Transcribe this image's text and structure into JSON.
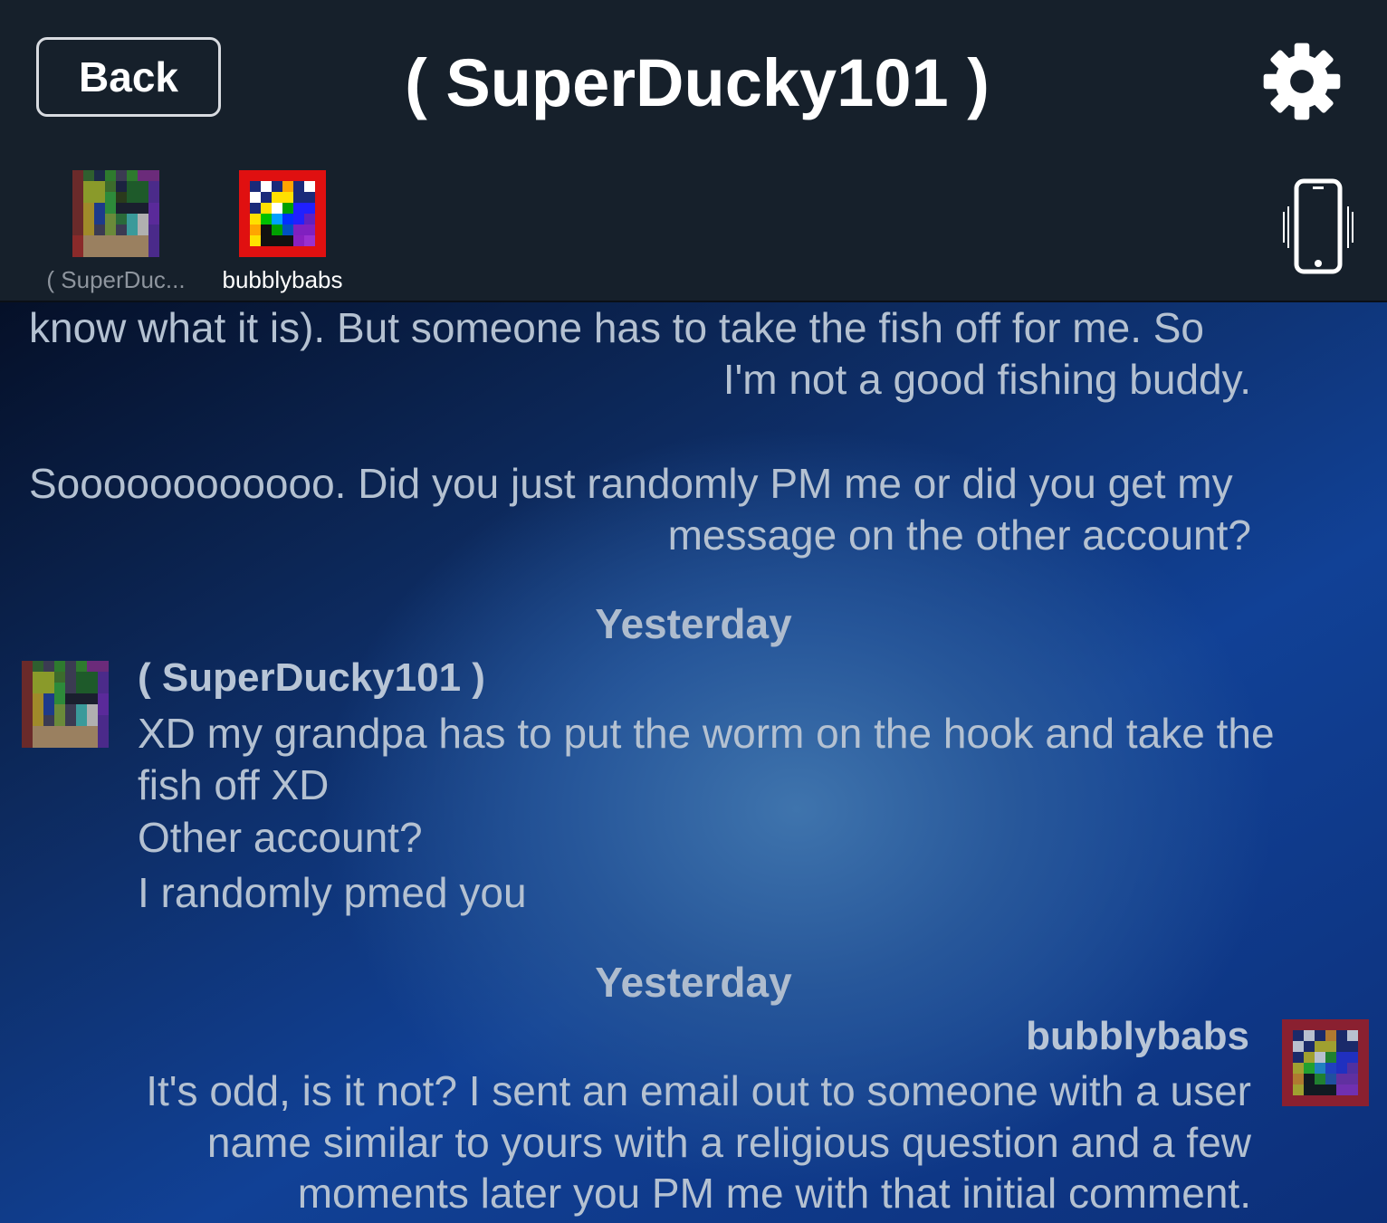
{
  "header": {
    "back_label": "Back",
    "title": "( SuperDucky101 )",
    "settings_icon": "gear-icon",
    "vibrate_icon": "phone-vibrate-icon"
  },
  "participants": [
    {
      "name": "( SuperDuc...",
      "avatar": "pixel-avatar-superducky"
    },
    {
      "name": "bubblybabs",
      "avatar": "pixel-avatar-bubblybabs"
    }
  ],
  "messages": {
    "top": {
      "lines": [
        "know what it is).  But someone has to take the fish off for me.  So",
        "I'm not a good fishing buddy.",
        "Soooooooooooo.  Did you just randomly PM me or did you get my",
        "message on the other account?"
      ]
    },
    "group1": {
      "timestamp": "Yesterday",
      "sender": "( SuperDucky101 )",
      "lines": [
        "XD my grandpa has to put the worm on the hook and take the",
        "fish off XD",
        "Other account?",
        "I randomly pmed you"
      ]
    },
    "group2": {
      "timestamp": "Yesterday",
      "sender": "bubblybabs",
      "lines": [
        "It's odd, is it not?  I sent an email out to someone with a user",
        "name similar to yours with a religious question and a few",
        "moments later you PM me with that initial comment."
      ]
    }
  },
  "colors": {
    "header_bg": "#16202b",
    "chat_text": "#b4c1d1",
    "accent_white": "#ffffff"
  }
}
